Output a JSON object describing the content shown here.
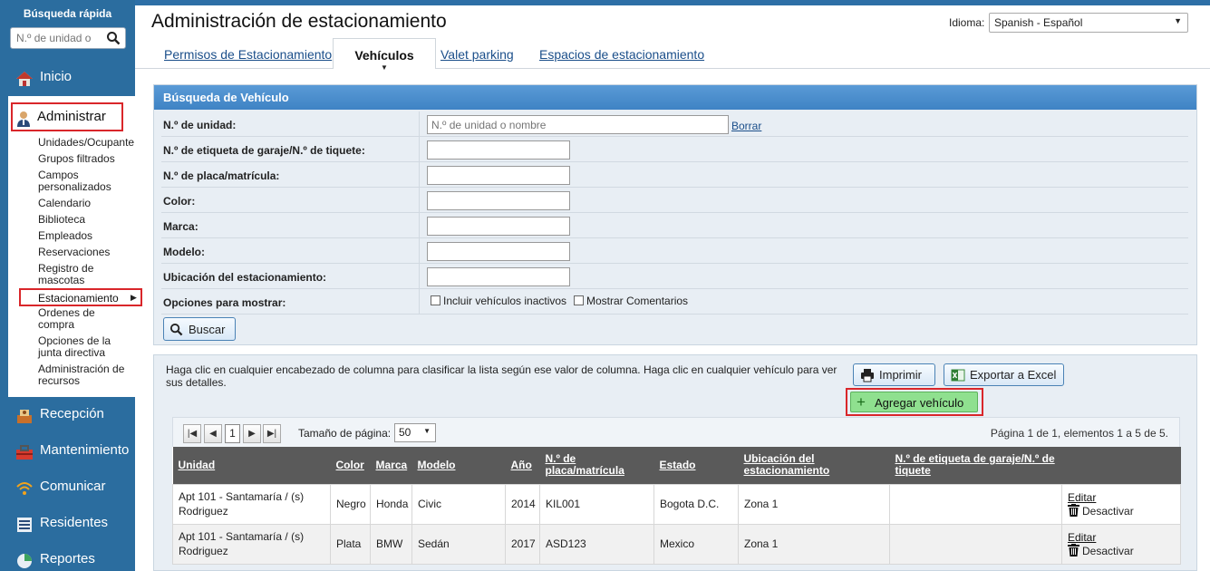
{
  "sidebar": {
    "quick_search_title": "Búsqueda rápida",
    "quick_search_placeholder": "N.º de unidad o",
    "nav": {
      "inicio": "Inicio",
      "administrar": "Administrar",
      "recepcion": "Recepción",
      "mantenimiento": "Mantenimiento",
      "comunicar": "Comunicar",
      "residentes": "Residentes",
      "reportes": "Reportes"
    },
    "admin_items": [
      "Unidades/Ocupante",
      "Grupos filtrados",
      "Campos personalizados",
      "Calendario",
      "Biblioteca",
      "Empleados",
      "Reservaciones",
      "Registro de mascotas",
      "Estacionamiento",
      "Ordenes de compra",
      "Opciones de la junta directiva",
      "Administración de recursos"
    ]
  },
  "header": {
    "title": "Administración de estacionamiento",
    "language_label": "Idioma:",
    "language_value": "Spanish - Español"
  },
  "tabs": [
    "Permisos de Estacionamiento",
    "Vehículos",
    "Valet parking",
    "Espacios de estacionamiento"
  ],
  "search": {
    "title": "Búsqueda de Vehículo",
    "fields": [
      "N.º de unidad:",
      "N.º de etiqueta de garaje/N.º de tiquete:",
      "N.º de placa/matrícula:",
      "Color:",
      "Marca:",
      "Modelo:",
      "Ubicación del estacionamiento:",
      "Opciones para mostrar:"
    ],
    "unit_placeholder": "N.º de unidad o nombre",
    "clear_label": "Borrar",
    "option_inactive": "Incluir vehículos inactivos",
    "option_comments": "Mostrar Comentarios",
    "search_button": "Buscar"
  },
  "results": {
    "help_text": "Haga clic en cualquier encabezado de columna para clasificar la lista según ese valor de columna. Haga clic en cualquier vehículo para ver sus detalles.",
    "print_button": "Imprimir",
    "export_button": "Exportar a Excel",
    "add_button": "Agregar vehículo",
    "pager": {
      "current_page": "1",
      "page_size_label": "Tamaño de página:",
      "page_size_value": "50",
      "info": "Página 1 de 1, elementos 1 a 5 de 5."
    },
    "columns": [
      "Unidad",
      "Color",
      "Marca",
      "Modelo",
      "Año",
      "N.º de placa/matrícula",
      "Estado",
      "Ubicación del estacionamiento",
      "N.º de etiqueta de garaje/N.º de tiquete",
      ""
    ],
    "rows": [
      {
        "unidad": "Apt 101 - Santamaría / (s) Rodriguez",
        "color": "Negro",
        "marca": "Honda",
        "modelo": "Civic",
        "anio": "2014",
        "placa": "KIL001",
        "estado": "Bogota D.C.",
        "ubicacion": "Zona 1",
        "etiqueta": "",
        "edit": "Editar",
        "deactivate": "Desactivar"
      },
      {
        "unidad": "Apt 101 - Santamaría / (s) Rodriguez",
        "color": "Plata",
        "marca": "BMW",
        "modelo": "Sedán",
        "anio": "2017",
        "placa": "ASD123",
        "estado": "Mexico",
        "ubicacion": "Zona 1",
        "etiqueta": "",
        "edit": "Editar",
        "deactivate": "Desactivar"
      }
    ]
  }
}
